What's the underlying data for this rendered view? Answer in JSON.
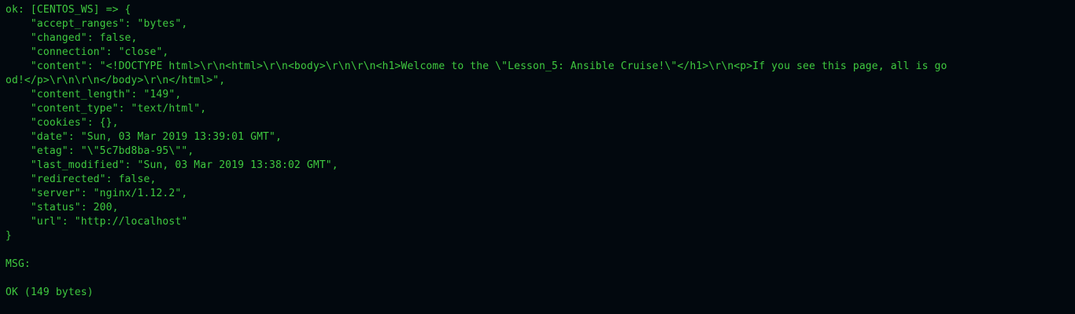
{
  "terminal": {
    "text_color": "#3fc93f",
    "background": "#02080e",
    "lines": [
      "ok: [CENTOS_WS] => {",
      "    \"accept_ranges\": \"bytes\",",
      "    \"changed\": false,",
      "    \"connection\": \"close\",",
      "    \"content\": \"<!DOCTYPE html>\\r\\n<html>\\r\\n<body>\\r\\n\\r\\n<h1>Welcome to the \\\"Lesson_5: Ansible Cruise!\\\"</h1>\\r\\n<p>If you see this page, all is go",
      "od!</p>\\r\\n\\r\\n</body>\\r\\n</html>\",",
      "    \"content_length\": \"149\",",
      "    \"content_type\": \"text/html\",",
      "    \"cookies\": {},",
      "    \"date\": \"Sun, 03 Mar 2019 13:39:01 GMT\",",
      "    \"etag\": \"\\\"5c7bd8ba-95\\\"\",",
      "    \"last_modified\": \"Sun, 03 Mar 2019 13:38:02 GMT\",",
      "    \"redirected\": false,",
      "    \"server\": \"nginx/1.12.2\",",
      "    \"status\": 200,",
      "    \"url\": \"http://localhost\"",
      "}",
      "",
      "MSG:",
      "",
      "OK (149 bytes)"
    ]
  }
}
